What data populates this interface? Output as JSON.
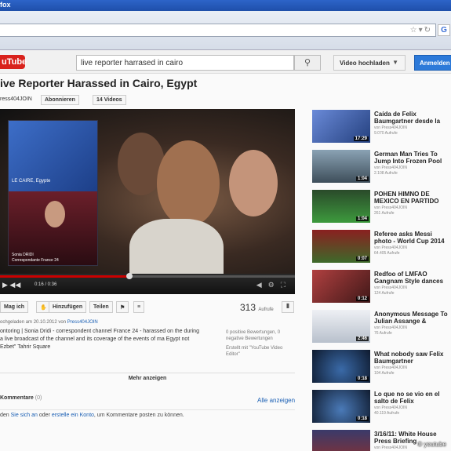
{
  "browser": {
    "window_title": "fox",
    "google_icon": "G"
  },
  "header": {
    "logo_pre": "",
    "logo": "uTube",
    "search_value": "live reporter harrased in cairo",
    "search_icon": "magnifier-icon",
    "upload_label": "Video hochladen",
    "signin_label": "Anmelden"
  },
  "video": {
    "title": "ive Reporter Harassed in Cairo, Egypt",
    "channel": "ress404JOIN",
    "subscribe_label": "Abonnieren",
    "videos_label": "14 Videos",
    "inset_label_top": "LE CAIRE, Egypte",
    "inset_label_bottom_1": "Sonia DRIDI",
    "inset_label_bottom_2": "Correspondante France 24",
    "time": "0:16 / 0:36",
    "progress_fraction": 0.44
  },
  "actions": {
    "like_label": "Mag ich",
    "add_label": "Hinzufügen",
    "share_label": "Teilen",
    "flag_icon": "flag-icon",
    "views": "313",
    "views_suffix": "Aufrufe"
  },
  "details": {
    "meta_prefix": "ochgeladen am 20.10.2012 von",
    "meta_channel": "Press404JOIN",
    "description": "ontoring | Sonia Dridi - correspondent channel France 24 - harassed on the during a live broadcast of the channel and its coverage of the events of ma Egypt not Ezbet\" Tahrir Square",
    "ratings": "0 positive Bewertungen, 0 negative Bewertungen",
    "twitter": "Erstellt mit \"YouTube Video Editor\"",
    "more_label": "Mehr anzeigen",
    "comments_label": "Kommentare",
    "comments_count": "(0)",
    "show_all": "Alle anzeigen",
    "comment_prompt_1": "den",
    "comment_prompt_link1": "Sie sich an",
    "comment_prompt_mid": "oder",
    "comment_prompt_link2": "erstelle ein Konto",
    "comment_prompt_end": ", um Kommentare posten zu können."
  },
  "sidebar": [
    {
      "title": "Caída de Felix Baumgartner desde la",
      "by": "von Press404JOIN",
      "views": "9.070 Aufrufe",
      "duration": "17:29",
      "color": "#3a5aa8"
    },
    {
      "title": "German Man Tries To Jump Into Frozen Pool",
      "by": "von Press404JOIN",
      "views": "2.108 Aufrufe",
      "duration": "1:04",
      "color": "#5a6e7c"
    },
    {
      "title": "POHEN HIMNO DE MEXICO EN PARTIDO",
      "by": "von Press404JOIN",
      "views": "261 Aufrufe",
      "duration": "1:04",
      "color": "#2f8a2f"
    },
    {
      "title": "Referee asks Messi photo - World Cup 2014",
      "by": "von Press404JOIN",
      "views": "64.405 Aufrufe",
      "duration": "0:07",
      "color": "#6a8a3a"
    },
    {
      "title": "Redfoo of LMFAO Gangnam Style dances",
      "by": "von Press404JOIN",
      "views": "124 Aufrufe",
      "duration": "0:12",
      "color": "#8a3a3a"
    },
    {
      "title": "Anonymous Message To Julian Assange &",
      "by": "von Press404JOIN",
      "views": "76 Aufrufe",
      "duration": "2:46",
      "color": "#d8dde4"
    },
    {
      "title": "What nobody saw Felix Baumgartner",
      "by": "von Press404JOIN",
      "views": "104 Aufrufe",
      "duration": "0:18",
      "color": "#1c2f4a"
    },
    {
      "title": "Lo que no se vio en el salto de Felix",
      "by": "von Press404JOIN",
      "views": "40.119 Aufrufe",
      "duration": "0:18",
      "color": "#22344e"
    },
    {
      "title": "3/16/11: White House Press Briefing",
      "by": "von Press404JOIN",
      "views": "",
      "duration": "",
      "color": "#4a4a7a"
    }
  ],
  "credit": "© youtube"
}
